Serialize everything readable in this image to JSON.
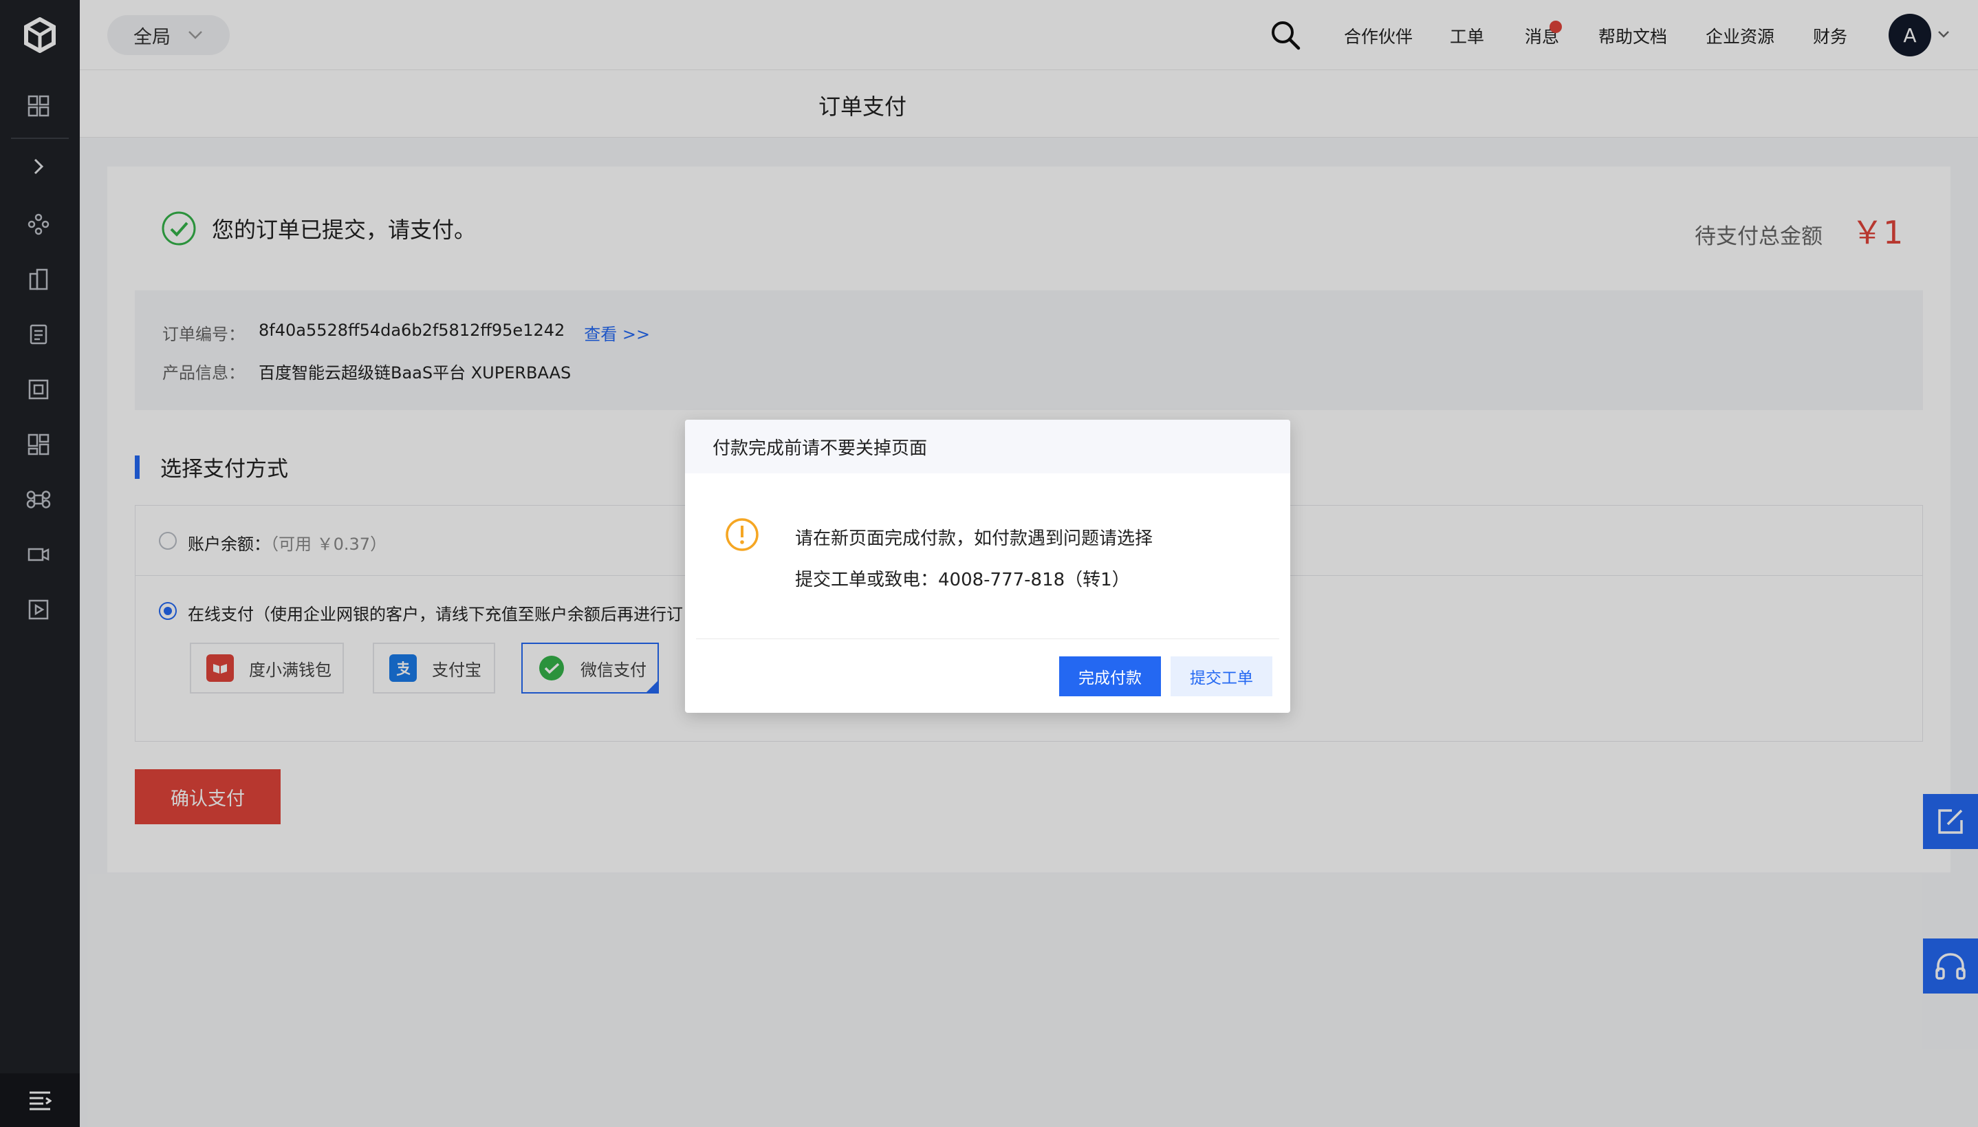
{
  "topbar": {
    "region": "全局",
    "nav": [
      "合作伙伴",
      "工单",
      "消息",
      "帮助文档",
      "企业资源",
      "财务"
    ],
    "avatar_letter": "A"
  },
  "subheader": {
    "title": "订单支付"
  },
  "order": {
    "success_text": "您的订单已提交，请支付。",
    "total_label": "待支付总金额",
    "total_amount": "￥1",
    "order_no_label": "订单编号：",
    "order_no": "8f40a5528ff54da6b2f5812ff95e1242",
    "view_link": "查看 >>",
    "product_label": "产品信息：",
    "product": "百度智能云超级链BaaS平台 XUPERBAAS"
  },
  "payment": {
    "section_title": "选择支付方式",
    "balance_label": "账户余额：",
    "balance_avail": "（可用 ￥0.37）",
    "online_label": "在线支付（使用企业网银的客户，请线下充值至账户余额后再进行订",
    "methods": [
      "度小满钱包",
      "支付宝",
      "微信支付"
    ],
    "selected_method": "微信支付",
    "confirm": "确认支付"
  },
  "modal": {
    "title": "付款完成前请不要关掉页面",
    "line1": "请在新页面完成付款，如付款遇到问题请选择",
    "line2": "提交工单或致电：4008-777-818（转1）",
    "primary": "完成付款",
    "secondary": "提交工单"
  },
  "colors": {
    "brand": "#2468f2",
    "danger": "#e0443a",
    "sidebar": "#1f2126",
    "warning": "#f5a623"
  }
}
